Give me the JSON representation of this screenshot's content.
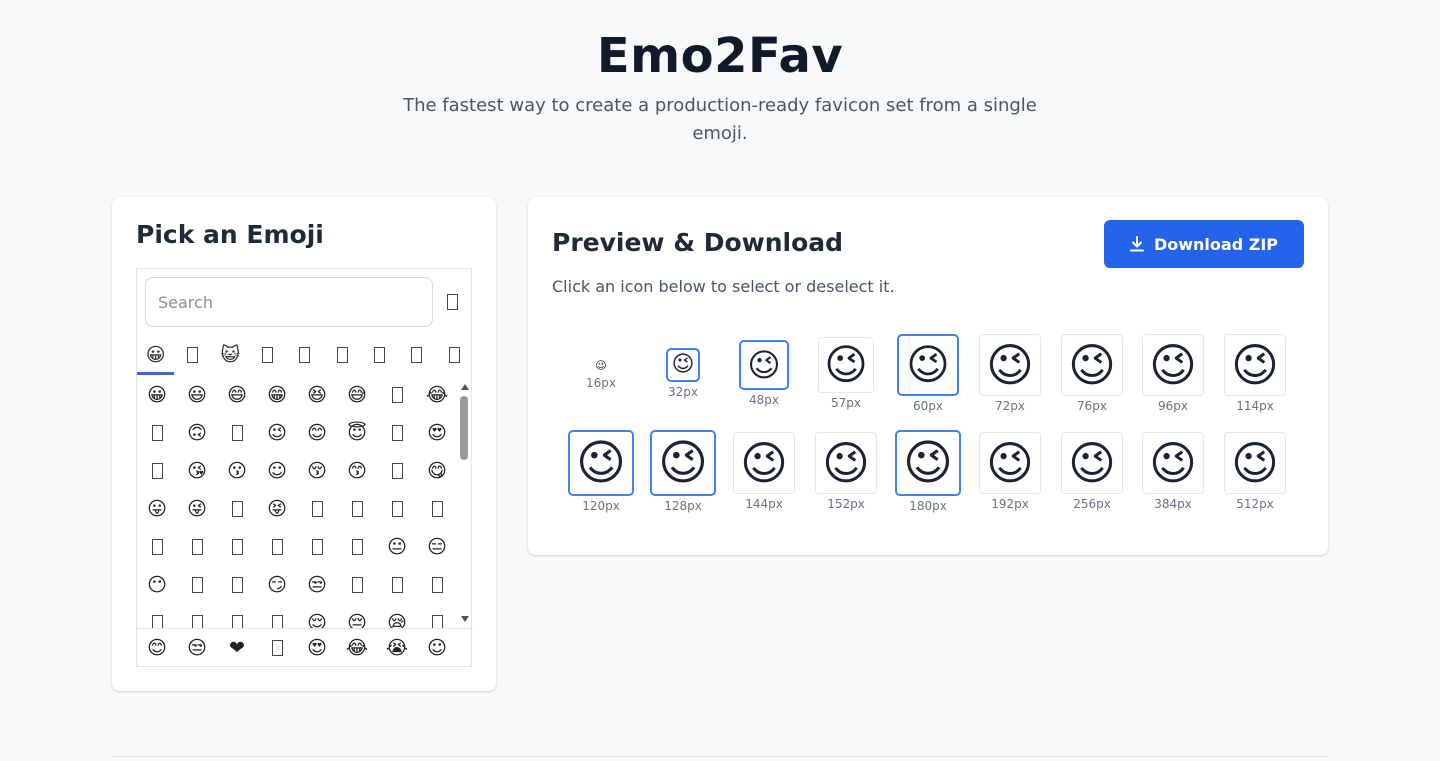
{
  "hero": {
    "title": "Emo2Fav",
    "subtitle": "The fastest way to create a production-ready favicon set from a single emoji."
  },
  "picker": {
    "title": "Pick an Emoji",
    "search_placeholder": "Search",
    "categories": [
      {
        "glyph": "😀",
        "active": true
      },
      {
        "glyph": "",
        "active": false
      },
      {
        "glyph": "😺",
        "active": false
      },
      {
        "glyph": "",
        "active": false
      },
      {
        "glyph": "",
        "active": false
      },
      {
        "glyph": "",
        "active": false
      },
      {
        "glyph": "",
        "active": false
      },
      {
        "glyph": "",
        "active": false
      },
      {
        "glyph": "",
        "active": false
      }
    ],
    "grid": [
      [
        "😀",
        "😃",
        "😄",
        "😁",
        "😆",
        "😅",
        "",
        "😂"
      ],
      [
        "",
        "🙃",
        "",
        "😉",
        "😊",
        "😇",
        "",
        "😍"
      ],
      [
        "",
        "😘",
        "😗",
        "☺",
        "😚",
        "😙",
        "",
        "😋"
      ],
      [
        "😛",
        "😜",
        "",
        "😝",
        "",
        "",
        "",
        ""
      ],
      [
        "",
        "",
        "",
        "",
        "",
        "",
        "😐",
        "😑"
      ],
      [
        "😶",
        "",
        "",
        "😏",
        "😒",
        "",
        "",
        ""
      ],
      [
        "",
        "",
        "",
        "",
        "😌",
        "😔",
        "😪",
        ""
      ]
    ],
    "recent": [
      "😊",
      "😒",
      "❤",
      "",
      "😍",
      "😂",
      "😭",
      "☺"
    ]
  },
  "preview": {
    "title": "Preview & Download",
    "hint": "Click an icon below to select or deselect it.",
    "download_label": "Download ZIP",
    "emoji": "😉",
    "accent": "#2563eb",
    "selected_border": "#3b82f6",
    "icons": [
      {
        "label": "16px",
        "selected": false
      },
      {
        "label": "32px",
        "selected": true
      },
      {
        "label": "48px",
        "selected": true
      },
      {
        "label": "57px",
        "selected": false
      },
      {
        "label": "60px",
        "selected": true
      },
      {
        "label": "72px",
        "selected": false
      },
      {
        "label": "76px",
        "selected": false
      },
      {
        "label": "96px",
        "selected": false
      },
      {
        "label": "114px",
        "selected": false
      },
      {
        "label": "120px",
        "selected": true
      },
      {
        "label": "128px",
        "selected": true
      },
      {
        "label": "144px",
        "selected": false
      },
      {
        "label": "152px",
        "selected": false
      },
      {
        "label": "180px",
        "selected": true
      },
      {
        "label": "192px",
        "selected": false
      },
      {
        "label": "256px",
        "selected": false
      },
      {
        "label": "384px",
        "selected": false
      },
      {
        "label": "512px",
        "selected": false
      }
    ]
  }
}
